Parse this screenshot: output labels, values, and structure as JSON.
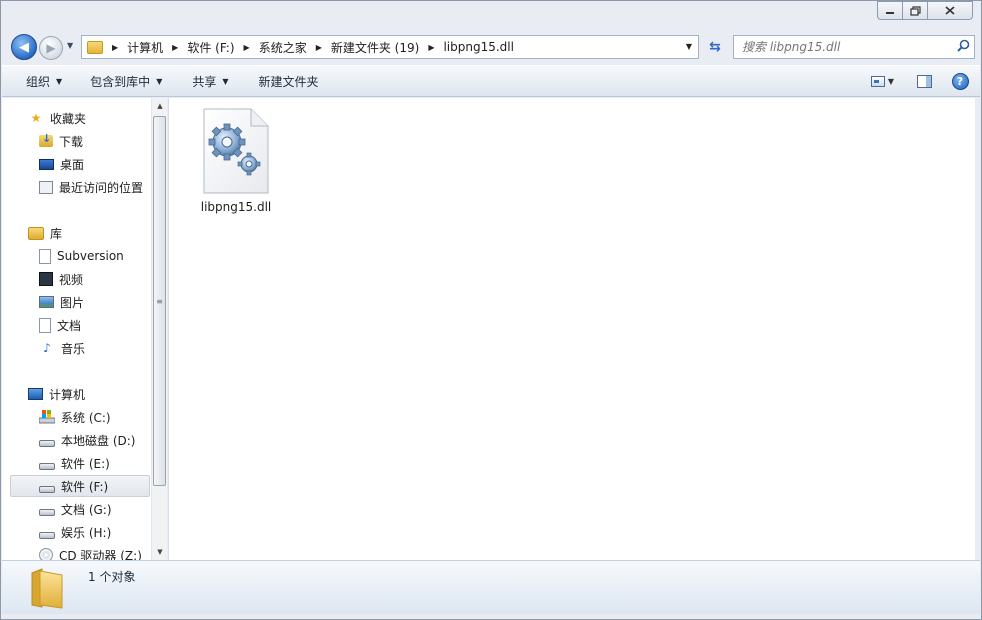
{
  "window": {
    "caption_buttons": [
      "minimize",
      "maximize",
      "close"
    ]
  },
  "nav": {
    "address_crumbs": [
      "计算机",
      "软件 (F:)",
      "系统之家",
      "新建文件夹 (19)",
      "libpng15.dll"
    ],
    "search_placeholder": "搜索 libpng15.dll"
  },
  "toolbar": {
    "organize": "组织",
    "include_in_library": "包含到库中",
    "share": "共享",
    "new_folder": "新建文件夹"
  },
  "sidebar": {
    "favorites": {
      "label": "收藏夹",
      "items": [
        {
          "label": "下载",
          "icon": "download-folder-icon"
        },
        {
          "label": "桌面",
          "icon": "desktop-icon"
        },
        {
          "label": "最近访问的位置",
          "icon": "recent-places-icon"
        }
      ]
    },
    "libraries": {
      "label": "库",
      "items": [
        {
          "label": "Subversion",
          "icon": "document-icon"
        },
        {
          "label": "视频",
          "icon": "video-icon"
        },
        {
          "label": "图片",
          "icon": "picture-icon"
        },
        {
          "label": "文档",
          "icon": "document-icon"
        },
        {
          "label": "音乐",
          "icon": "music-icon"
        }
      ]
    },
    "computer": {
      "label": "计算机",
      "items": [
        {
          "label": "系统 (C:)",
          "icon": "system-drive-icon"
        },
        {
          "label": "本地磁盘 (D:)",
          "icon": "drive-icon"
        },
        {
          "label": "软件 (E:)",
          "icon": "drive-icon"
        },
        {
          "label": "软件 (F:)",
          "icon": "drive-icon",
          "selected": true
        },
        {
          "label": "文档 (G:)",
          "icon": "drive-icon"
        },
        {
          "label": "娱乐 (H:)",
          "icon": "drive-icon"
        },
        {
          "label": "CD 驱动器 (Z:)",
          "icon": "cd-drive-icon"
        }
      ]
    }
  },
  "content": {
    "files": [
      {
        "name": "libpng15.dll",
        "icon": "dll-gear-file-icon"
      }
    ]
  },
  "details": {
    "summary": "1 个对象"
  },
  "colors": {
    "window_frame": "#e9edf3",
    "toolbar_text": "#1e2b3c",
    "accent_blue": "#2b6cc4",
    "selection_bg": "#e2e6ec"
  }
}
